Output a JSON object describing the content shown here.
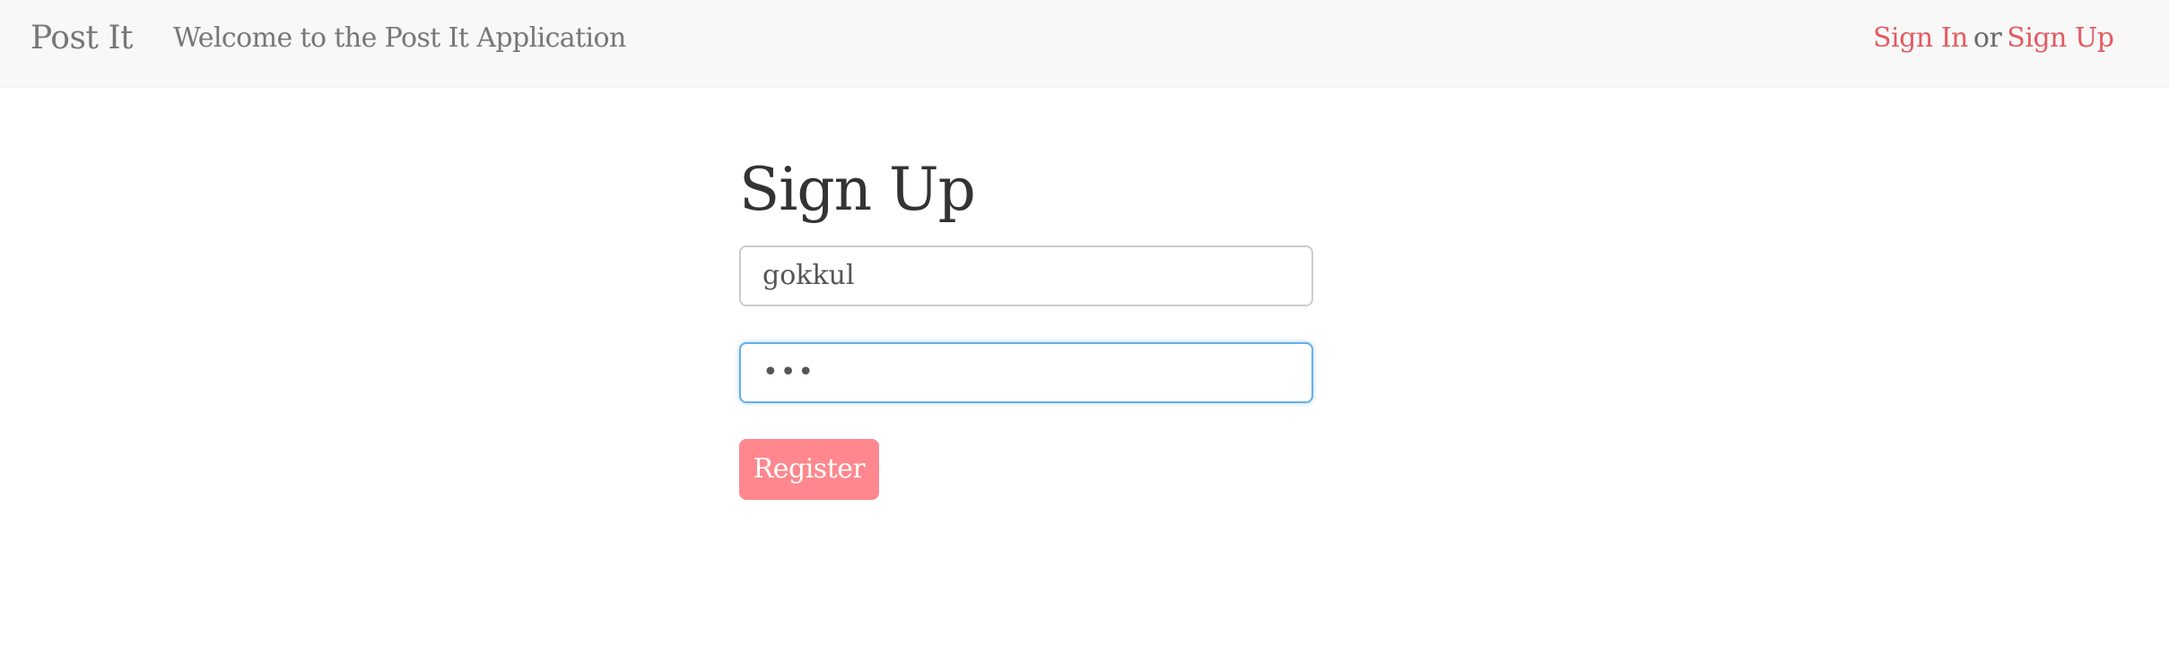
{
  "navbar": {
    "brand": "Post It",
    "tagline": "Welcome to the Post It Application",
    "sign_in_label": "Sign In",
    "separator": "or",
    "sign_up_label": "Sign Up"
  },
  "form": {
    "title": "Sign Up",
    "username_value": "gokkul",
    "password_value": "•••",
    "register_label": "Register"
  },
  "colors": {
    "navbar_bg": "#f8f8f8",
    "link": "#e45a61",
    "button_bg": "#ff878d",
    "focus_border": "#66afe9"
  }
}
